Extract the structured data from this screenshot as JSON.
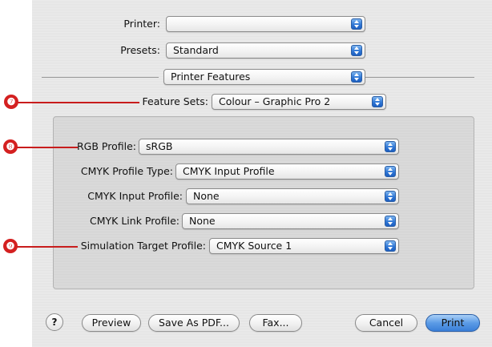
{
  "header": {
    "printer_label": "Printer:",
    "printer_value": "",
    "presets_label": "Presets:",
    "presets_value": "Standard",
    "pane_value": "Printer Features",
    "feature_sets_label": "Feature Sets:",
    "feature_sets_value": "Colour – Graphic Pro 2"
  },
  "features": {
    "rgb_profile_label": "RGB Profile:",
    "rgb_profile_value": "sRGB",
    "cmyk_profile_type_label": "CMYK Profile Type:",
    "cmyk_profile_type_value": "CMYK Input Profile",
    "cmyk_input_profile_label": "CMYK Input Profile:",
    "cmyk_input_profile_value": "None",
    "cmyk_link_profile_label": "CMYK Link Profile:",
    "cmyk_link_profile_value": "None",
    "simulation_target_label": "Simulation Target Profile:",
    "simulation_target_value": "CMYK Source 1"
  },
  "callouts": {
    "seven": "❼",
    "eight": "❽",
    "nine": "❾"
  },
  "footer": {
    "help_label": "?",
    "preview_label": "Preview",
    "save_pdf_label": "Save As PDF...",
    "fax_label": "Fax...",
    "cancel_label": "Cancel",
    "print_label": "Print"
  },
  "colors": {
    "callout": "#d42020",
    "accent_blue": "#3a7fd8"
  }
}
